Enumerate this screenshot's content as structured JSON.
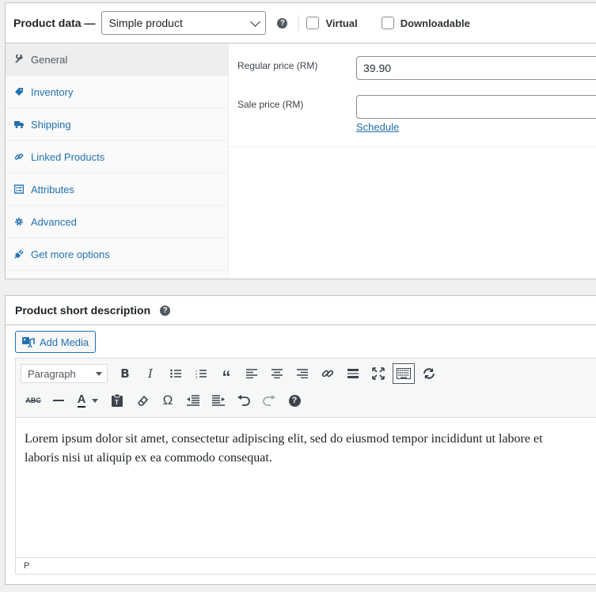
{
  "product_data": {
    "title": "Product data —",
    "type_select": "Simple product",
    "help": "?",
    "virtual_label": "Virtual",
    "downloadable_label": "Downloadable",
    "tabs": [
      {
        "label": "General",
        "icon": "wrench-icon"
      },
      {
        "label": "Inventory",
        "icon": "tag-icon"
      },
      {
        "label": "Shipping",
        "icon": "truck-icon"
      },
      {
        "label": "Linked Products",
        "icon": "link-icon"
      },
      {
        "label": "Attributes",
        "icon": "list-icon"
      },
      {
        "label": "Advanced",
        "icon": "gear-icon"
      },
      {
        "label": "Get more options",
        "icon": "plugin-icon"
      }
    ],
    "regular_price_label": "Regular price (RM)",
    "regular_price_value": "39.90",
    "sale_price_label": "Sale price (RM)",
    "sale_price_value": "",
    "schedule_link": "Schedule"
  },
  "short_description": {
    "title": "Product short description",
    "help": "?",
    "add_media": "Add Media",
    "format_select": "Paragraph",
    "content_line1": "Lorem ipsum dolor sit amet, consectetur adipiscing elit, sed do eiusmod tempor incididunt ut labore et",
    "content_line2": "laboris nisi ut aliquip ex ea commodo consequat.",
    "status_path": "P"
  },
  "colors": {
    "link": "#2271b1",
    "border": "#c3c4c7",
    "text": "#1d2327"
  }
}
